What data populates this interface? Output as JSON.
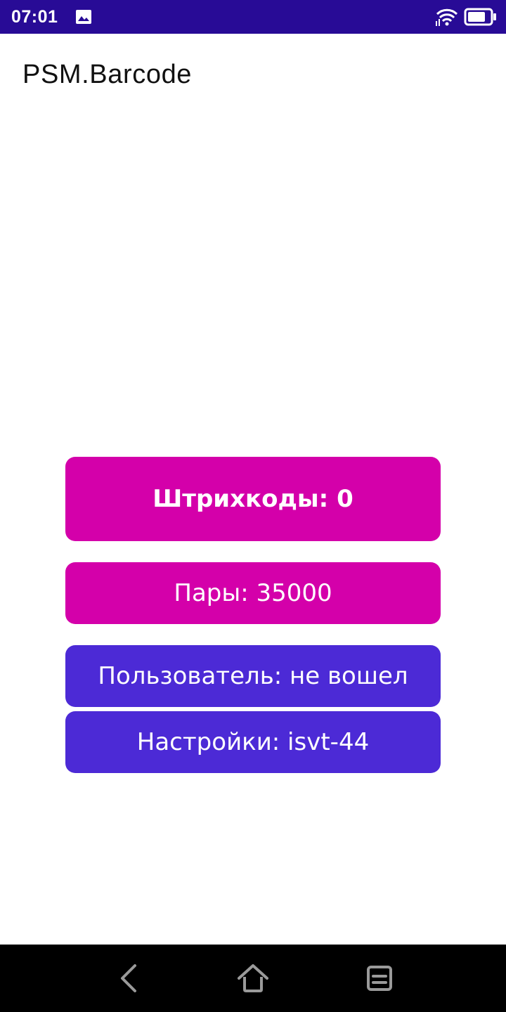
{
  "status_bar": {
    "time": "07:01",
    "icons": [
      "image-icon",
      "wifi-icon",
      "battery-icon"
    ],
    "background": "#280b96"
  },
  "app": {
    "title": "PSM.Barcode"
  },
  "buttons": {
    "barcodes": "Штрихкоды: 0",
    "pairs": "Пары: 35000",
    "user": "Пользователь: не вошел",
    "settings": "Настройки: isvt-44"
  },
  "colors": {
    "primary_button": "#d400aa",
    "secondary_button": "#4c2ad6"
  },
  "nav_bar": {
    "icons": [
      "back-icon",
      "home-icon",
      "recent-apps-icon"
    ]
  }
}
